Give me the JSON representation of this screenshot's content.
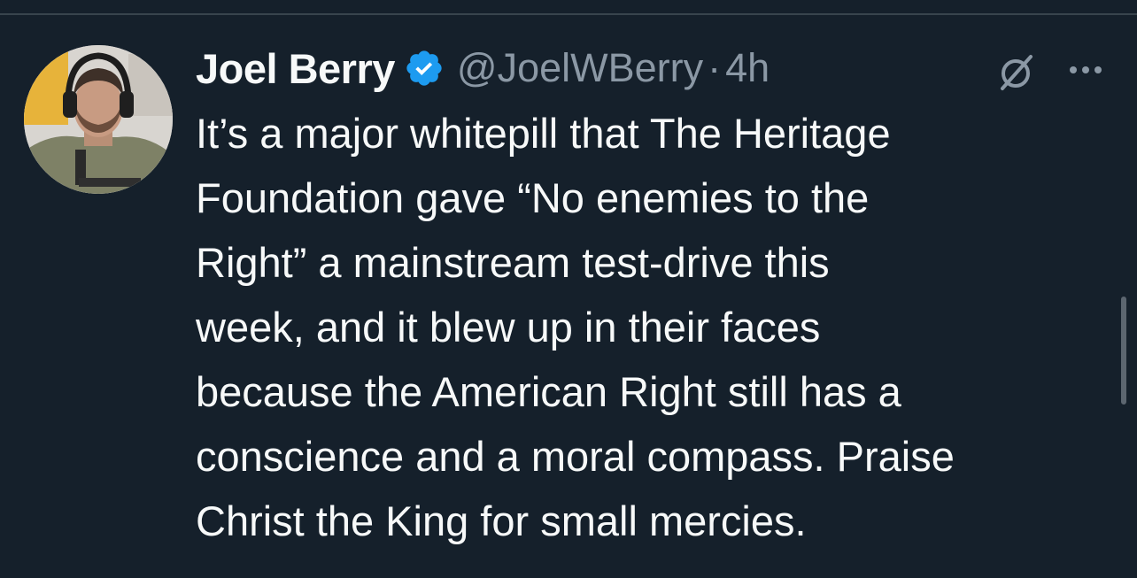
{
  "tweet": {
    "author_name": "Joel Berry",
    "handle": "@JoelWBerry",
    "separator": "·",
    "time": "4h",
    "verified": true,
    "text_lines": [
      "It’s a major whitepill that The Heritage",
      "Foundation gave “No enemies to the",
      "Right” a mainstream test-drive this",
      "week, and it blew up in their faces",
      "because the American Right still has a",
      "conscience and a moral compass. Praise",
      "Christ the King for small mercies."
    ]
  },
  "icons": {
    "verified": "verified-badge-icon",
    "grok": "grok-icon",
    "more": "more-options-icon"
  },
  "colors": {
    "background": "#15202b",
    "text": "#f7f9f9",
    "secondary_text": "#8b98a5",
    "verified_blue": "#1d9bf0",
    "divider": "#38444d"
  }
}
